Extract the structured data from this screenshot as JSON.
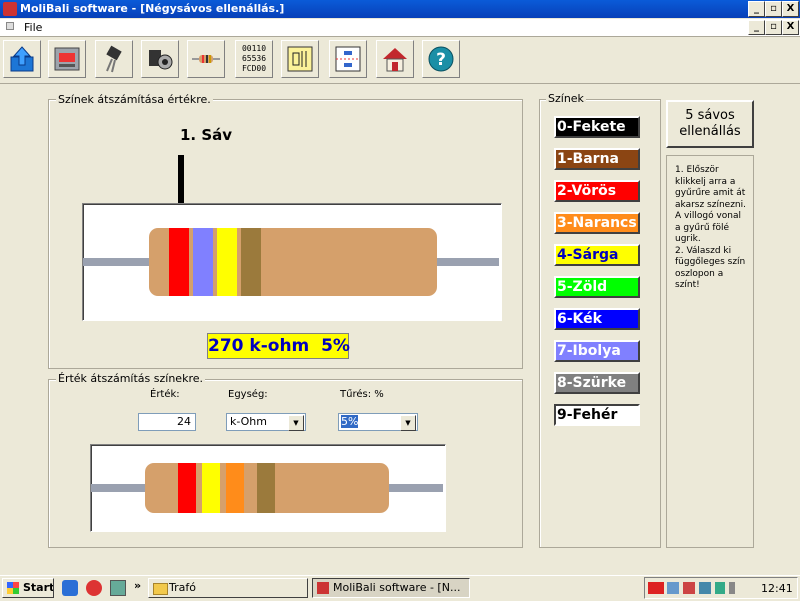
{
  "window": {
    "title": "MoliBali software  - [Négysávos ellenállás.]",
    "controls": {
      "minimize": "_",
      "maximize": "▫",
      "close": "X"
    }
  },
  "menu": {
    "file": "File"
  },
  "toolbar": {
    "buttons": [
      {
        "name": "export-arrow-icon"
      },
      {
        "name": "calculator-device-icon"
      },
      {
        "name": "transistor-icon"
      },
      {
        "name": "speaker-icon"
      },
      {
        "name": "resistor-icon"
      },
      {
        "name": "hex-converter-icon",
        "text": "00110\n65536\nFCD00"
      },
      {
        "name": "circuit-icon"
      },
      {
        "name": "schematic-icon"
      },
      {
        "name": "home-icon"
      },
      {
        "name": "help-icon"
      }
    ]
  },
  "upper_group": {
    "title": "Színek átszámítása értékre.",
    "band_label": "1. Sáv",
    "result": "270 k-ohm  5%",
    "bands": [
      "#FF0000",
      "#8080FF",
      "#FFFF00",
      "#9B7A3C"
    ]
  },
  "lower_group": {
    "title": "Érték átszámítás színekre.",
    "value_label": "Érték:",
    "value": "24",
    "unit_label": "Egység:",
    "unit": "k-Ohm",
    "tolerance_label": "Tűrés: %",
    "tolerance": "5%",
    "bands": [
      "#FF0000",
      "#FFFF00",
      "#FF8C1A",
      "#9B7A3C"
    ]
  },
  "colors_group": {
    "title": "Színek",
    "items": [
      {
        "label": "0-Fekete",
        "bg": "#000000",
        "fg": "#FFFFFF"
      },
      {
        "label": "1-Barna",
        "bg": "#8B4513",
        "fg": "#FFFFFF"
      },
      {
        "label": "2-Vörös",
        "bg": "#FF0000",
        "fg": "#FFFFFF"
      },
      {
        "label": "3-Narancs",
        "bg": "#FF8C1A",
        "fg": "#FFFFFF"
      },
      {
        "label": "4-Sárga",
        "bg": "#FFFF00",
        "fg": "#0000C0"
      },
      {
        "label": "5-Zöld",
        "bg": "#00FF00",
        "fg": "#FFFFFF"
      },
      {
        "label": "6-Kék",
        "bg": "#0000FF",
        "fg": "#FFFFFF"
      },
      {
        "label": "7-Ibolya",
        "bg": "#8080FF",
        "fg": "#FFFFFF"
      },
      {
        "label": "8-Szürke",
        "bg": "#808080",
        "fg": "#FFFFFF"
      },
      {
        "label": "9-Fehér",
        "bg": "#FFFFFF",
        "fg": "#000000"
      }
    ]
  },
  "five_band_button": "5 sávos\nellenállás",
  "help_text": "1. Először klikkelj arra a gyűrűre amit át akarsz színezni.\nA villogó vonal a gyűrű fölé ugrik.\n2. Válaszd ki függőleges szín oszlopon a színt!",
  "taskbar": {
    "start": "Start",
    "chevron": "»",
    "items": [
      "Trafó",
      "MoliBali software  - [N..."
    ],
    "clock": "12:41"
  }
}
